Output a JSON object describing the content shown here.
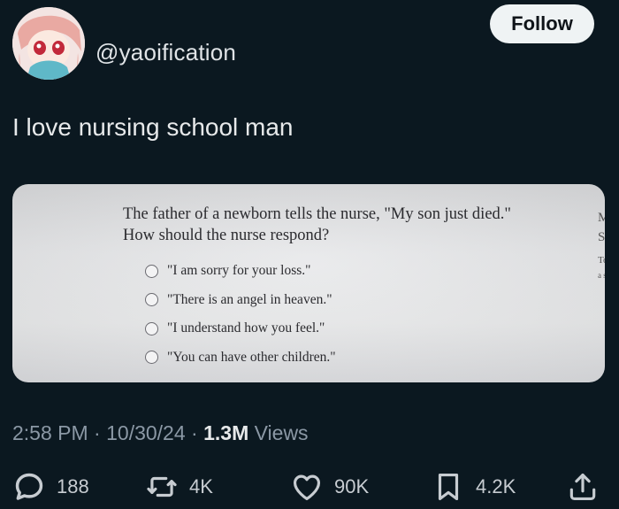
{
  "header": {
    "handle": "@yaoification",
    "follow_label": "Follow"
  },
  "tweet": {
    "text": "I love nursing school man"
  },
  "media": {
    "question_line1": "The father of a newborn tells the nurse, \"My son just died.\"",
    "question_line2": "How should the nurse respond?",
    "options": [
      "\"I am sorry for your loss.\"",
      "\"There is an angel in heaven.\"",
      "\"I understand how you feel.\"",
      "\"You can have other children.\""
    ],
    "side_fragments": [
      "M",
      "S",
      "To",
      "a s"
    ]
  },
  "meta": {
    "time": "2:58 PM",
    "date": "10/30/24",
    "views_count": "1.3M",
    "views_label": "Views",
    "separator": "·"
  },
  "actions": {
    "replies": "188",
    "reposts": "4K",
    "likes": "90K",
    "bookmarks": "4.2K"
  },
  "colors": {
    "background": "#0b1820",
    "follow_bg": "#eff3f4",
    "muted_text": "#8b98a5"
  }
}
